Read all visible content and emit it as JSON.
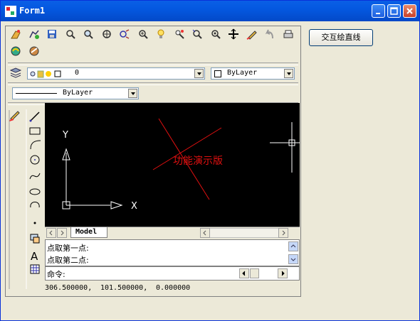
{
  "window": {
    "title": "Form1"
  },
  "action_button": {
    "label": "交互绘直线"
  },
  "layer": {
    "name": "0",
    "linetype_combo": "ByLayer",
    "lineweight_combo": "ByLayer"
  },
  "canvas": {
    "watermark": "功能演示版",
    "axis_y": "Y",
    "axis_x": "X"
  },
  "tabs": {
    "model": "Model"
  },
  "command": {
    "line1": "点取第一点:",
    "line2": "点取第二点:",
    "prompt": "命令:"
  },
  "status": {
    "x": "306.500000,",
    "y": "101.500000,",
    "z": "0.000000"
  }
}
